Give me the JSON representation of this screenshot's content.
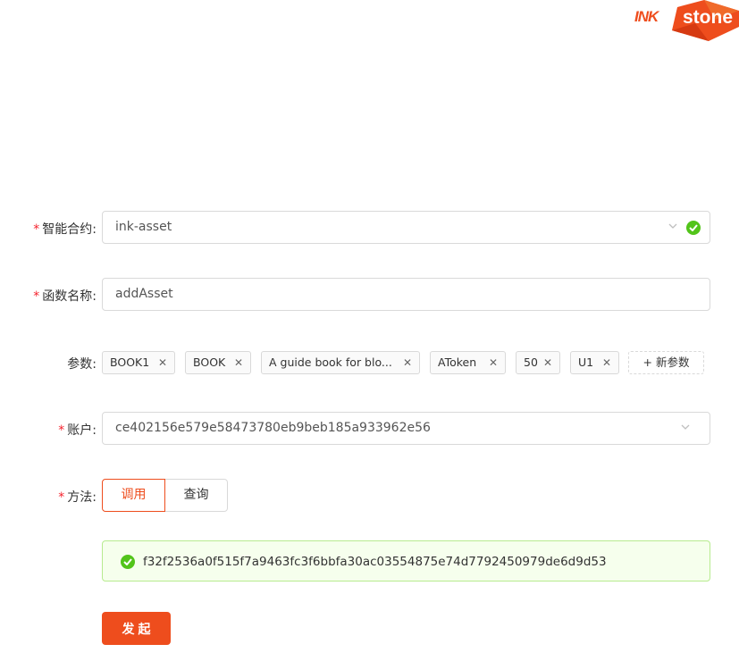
{
  "brand": {
    "logo_prefix": "INK",
    "logo_suffix": "stone",
    "accent": "#ee4d1d",
    "success": "#52c41a"
  },
  "form": {
    "contract": {
      "label": "智能合约:",
      "required": true,
      "value": "ink-asset",
      "validated": true
    },
    "function_name": {
      "label": "函数名称:",
      "required": true,
      "value": "addAsset"
    },
    "params": {
      "label": "参数:",
      "items": [
        "BOOK1",
        "BOOK",
        "A guide book for blo...",
        "AToken",
        "50",
        "U1"
      ],
      "add_label": "+ 新参数"
    },
    "account": {
      "label": "账户:",
      "required": true,
      "value": "ce402156e579e58473780eb9beb185a933962e56"
    },
    "method": {
      "label": "方法:",
      "required": true,
      "options": [
        "调用",
        "查询"
      ],
      "selected": "调用"
    },
    "result": {
      "status": "success",
      "text": "f32f2536a0f515f7a9463fc3f6bbfa30ac03554875e74d7792450979de6d9d53"
    },
    "submit_label": "发起"
  }
}
